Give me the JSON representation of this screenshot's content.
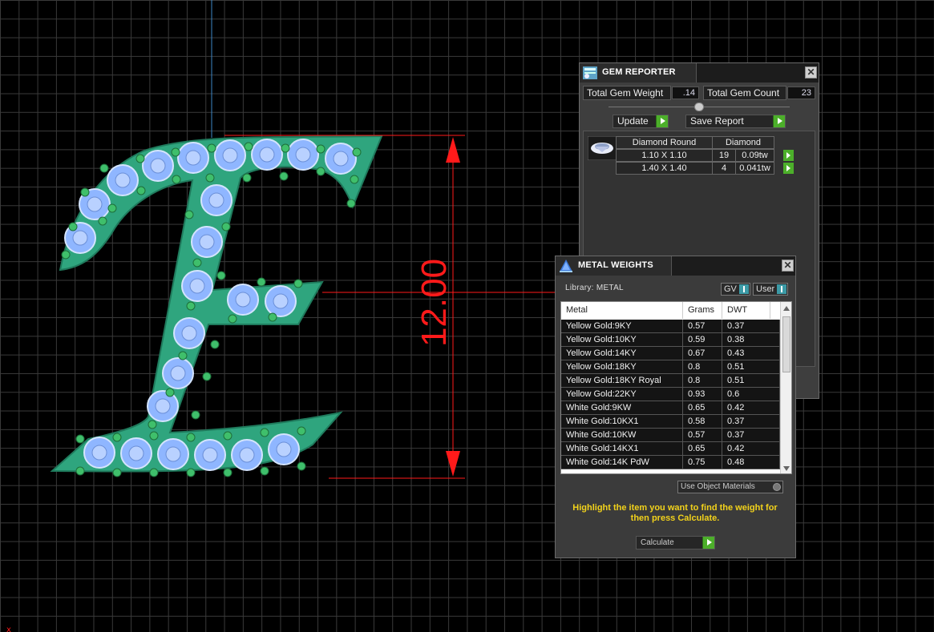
{
  "viewport": {
    "dimension_label": "12.00",
    "colors": {
      "background": "#000000",
      "grid": "#3a3a3a",
      "metal": "#2fa57e",
      "gem": "#8fb6ff",
      "dimension": "#ff1a1a"
    }
  },
  "gem_reporter": {
    "title": "GEM REPORTER",
    "close_glyph": "✕",
    "total_weight_label": "Total Gem Weight",
    "total_weight_value": ".14",
    "total_count_label": "Total Gem Count",
    "total_count_value": "23",
    "update_label": "Update",
    "save_report_label": "Save Report",
    "table": {
      "shape_header": "Diamond Round",
      "material_header": "Diamond",
      "rows": [
        {
          "size": "1.10 X 1.10",
          "count": "19",
          "weight": "0.09tw"
        },
        {
          "size": "1.40 X 1.40",
          "count": "4",
          "weight": "0.041tw"
        }
      ]
    }
  },
  "metal_weights": {
    "title": "METAL WEIGHTS",
    "close_glyph": "✕",
    "library_label": "Library: METAL",
    "gv_label": "GV",
    "user_label": "User",
    "columns": [
      "Metal",
      "Grams",
      "DWT"
    ],
    "rows": [
      {
        "metal": "Yellow Gold:9KY",
        "grams": "0.57",
        "dwt": "0.37"
      },
      {
        "metal": "Yellow Gold:10KY",
        "grams": "0.59",
        "dwt": "0.38"
      },
      {
        "metal": "Yellow Gold:14KY",
        "grams": "0.67",
        "dwt": "0.43"
      },
      {
        "metal": "Yellow Gold:18KY",
        "grams": "0.8",
        "dwt": "0.51"
      },
      {
        "metal": "Yellow Gold:18KY Royal",
        "grams": "0.8",
        "dwt": "0.51"
      },
      {
        "metal": "Yellow Gold:22KY",
        "grams": "0.93",
        "dwt": "0.6"
      },
      {
        "metal": "White Gold:9KW",
        "grams": "0.65",
        "dwt": "0.42"
      },
      {
        "metal": "White Gold:10KX1",
        "grams": "0.58",
        "dwt": "0.37"
      },
      {
        "metal": "White Gold:10KW",
        "grams": "0.57",
        "dwt": "0.37"
      },
      {
        "metal": "White Gold:14KX1",
        "grams": "0.65",
        "dwt": "0.42"
      },
      {
        "metal": "White Gold:14K PdW",
        "grams": "0.75",
        "dwt": "0.48"
      }
    ],
    "use_object_materials_label": "Use Object Materials",
    "instruction": "Highlight the item you want to find the weight for then press Calculate.",
    "calculate_label": "Calculate",
    "instruction_color": "#f2d21b"
  }
}
